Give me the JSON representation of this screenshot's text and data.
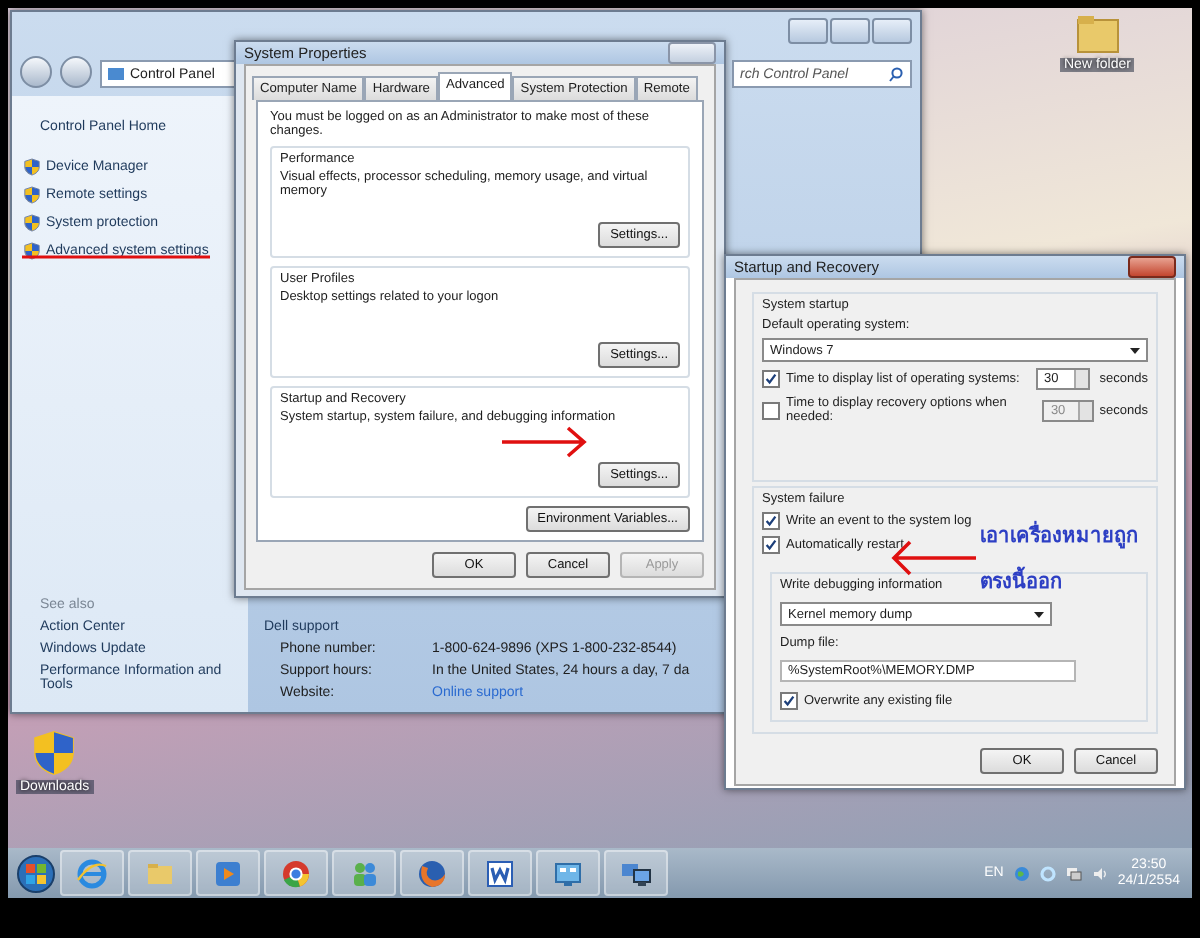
{
  "desktop": {
    "icons": [
      {
        "label": "New folder",
        "kind": "folder"
      },
      {
        "label": "Downloads",
        "kind": "shield"
      }
    ]
  },
  "control_panel": {
    "breadcrumb": "Control Panel",
    "search_placeholder": "rch Control Panel",
    "home_link": "Control Panel Home",
    "tasks": [
      "Device Manager",
      "Remote settings",
      "System protection",
      "Advanced system settings"
    ],
    "see_also_title": "See also",
    "see_also": [
      "Action Center",
      "Windows Update",
      "Performance Information and Tools"
    ],
    "support": {
      "title": "Dell support",
      "rows": [
        {
          "label": "Phone number:",
          "value": "1-800-624-9896 (XPS 1-800-232-8544)",
          "kind": "text"
        },
        {
          "label": "Support hours:",
          "value": "In the United States, 24 hours a day, 7 da",
          "kind": "text"
        },
        {
          "label": "Website:",
          "value": "Online support",
          "kind": "link"
        }
      ]
    }
  },
  "system_properties": {
    "title": "System Properties",
    "tabs": [
      {
        "label": "Computer Name",
        "selected": false
      },
      {
        "label": "Hardware",
        "selected": false
      },
      {
        "label": "Advanced",
        "selected": true
      },
      {
        "label": "System Protection",
        "selected": false
      },
      {
        "label": "Remote",
        "selected": false
      }
    ],
    "note": "You must be logged on as an Administrator to make most of these changes.",
    "groups": [
      {
        "title": "Performance",
        "description": "Visual effects, processor scheduling, memory usage, and virtual memory",
        "button": "Settings..."
      },
      {
        "title": "User Profiles",
        "description": "Desktop settings related to your logon",
        "button": "Settings..."
      },
      {
        "title": "Startup and Recovery",
        "description": "System startup, system failure, and debugging information",
        "button": "Settings..."
      }
    ],
    "env_button": "Environment Variables...",
    "buttons": [
      {
        "label": "OK",
        "disabled": false
      },
      {
        "label": "Cancel",
        "disabled": false
      },
      {
        "label": "Apply",
        "disabled": true
      }
    ]
  },
  "startup_recovery": {
    "title": "Startup and Recovery",
    "startup": {
      "title": "System startup",
      "os_label": "Default operating system:",
      "os_value": "Windows 7",
      "options": [
        {
          "label": "Time to display list of operating systems:",
          "checked": true,
          "value": "30",
          "unit": "seconds",
          "disabled": false
        },
        {
          "label": "Time to display recovery options when needed:",
          "checked": false,
          "value": "30",
          "unit": "seconds",
          "disabled": true
        }
      ]
    },
    "failure": {
      "title": "System failure",
      "options": [
        {
          "label": "Write an event to the system log",
          "checked": true
        },
        {
          "label": "Automatically restart",
          "checked": true
        }
      ],
      "debug_title": "Write debugging information",
      "debug_value": "Kernel memory dump",
      "dump_label": "Dump file:",
      "dump_value": "%SystemRoot%\\MEMORY.DMP",
      "overwrite": {
        "label": "Overwrite any existing file",
        "checked": true
      }
    },
    "buttons": [
      "OK",
      "Cancel"
    ]
  },
  "annotation": {
    "lines": [
      "เอาเครื่องหมายถูก",
      "ตรงนี้ออก"
    ]
  },
  "taskbar": {
    "apps": [
      {
        "kind": "ie"
      },
      {
        "kind": "folder"
      },
      {
        "kind": "media"
      },
      {
        "kind": "chrome"
      },
      {
        "kind": "people"
      },
      {
        "kind": "firefox"
      },
      {
        "kind": "word"
      },
      {
        "kind": "control"
      },
      {
        "kind": "network"
      }
    ],
    "language": "EN",
    "time": "23:50",
    "date": "24/1/2554"
  }
}
